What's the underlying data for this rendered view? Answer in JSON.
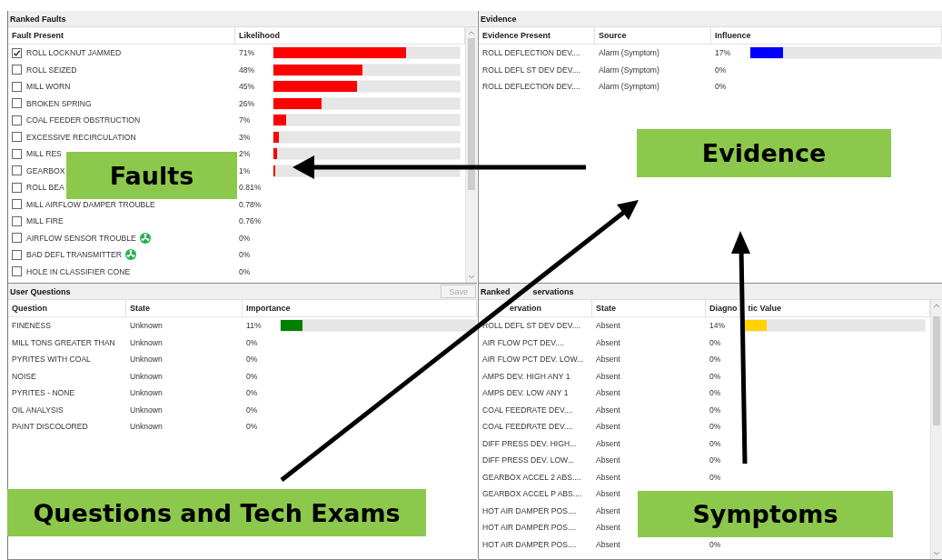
{
  "faults": {
    "title": "Ranked Faults",
    "columns": [
      "Fault Present",
      "Likelihood"
    ],
    "rows": [
      {
        "name": "ROLL LOCKNUT JAMMED",
        "checked": true,
        "icon": false,
        "value": "71%",
        "level": 0.71
      },
      {
        "name": "ROLL SEIZED",
        "checked": false,
        "icon": false,
        "value": "48%",
        "level": 0.48
      },
      {
        "name": "MILL WORN",
        "checked": false,
        "icon": false,
        "value": "45%",
        "level": 0.45
      },
      {
        "name": "BROKEN SPRING",
        "checked": false,
        "icon": false,
        "value": "26%",
        "level": 0.26
      },
      {
        "name": "COAL FEEDER OBSTRUCTION",
        "checked": false,
        "icon": false,
        "value": "7%",
        "level": 0.07
      },
      {
        "name": "EXCESSIVE RECIRCULATION",
        "checked": false,
        "icon": false,
        "value": "3%",
        "level": 0.03
      },
      {
        "name": "MILL RES",
        "checked": false,
        "icon": false,
        "value": "2%",
        "level": 0.02
      },
      {
        "name": "GEARBOX",
        "checked": false,
        "icon": false,
        "value": "1%",
        "level": 0.01
      },
      {
        "name": "ROLL BEA",
        "checked": false,
        "icon": false,
        "value": "0.81%"
      },
      {
        "name": "MILL AIRFLOW DAMPER TROUBLE",
        "checked": false,
        "icon": false,
        "value": "0.78%"
      },
      {
        "name": "MILL FIRE",
        "checked": false,
        "icon": false,
        "value": "0.76%"
      },
      {
        "name": "AIRFLOW SENSOR TROUBLE",
        "checked": false,
        "icon": true,
        "value": "0%"
      },
      {
        "name": "BAD DEFL TRANSMITTER",
        "checked": false,
        "icon": true,
        "value": "0%"
      },
      {
        "name": "HOLE IN CLASSIFIER CONE",
        "checked": false,
        "icon": false,
        "value": "0%"
      }
    ]
  },
  "evidence": {
    "title": "Evidence",
    "columns": [
      "Evidence Present",
      "Source",
      "Influence"
    ],
    "rows": [
      {
        "name": "ROLL DEFLECTION DEV....",
        "source": "Alarm (Symptom)",
        "value": "17%",
        "level": 0.17
      },
      {
        "name": "ROLL DEFL ST DEV DEV....",
        "source": "Alarm (Symptom)",
        "value": "0%"
      },
      {
        "name": "ROLL DEFLECTION DEV....",
        "source": "Alarm (Symptom)",
        "value": "0%"
      }
    ]
  },
  "questions": {
    "title": "User Questions",
    "save_button": {
      "label": "Save",
      "disabled": true
    },
    "columns": [
      "Question",
      "State",
      "Importance"
    ],
    "rows": [
      {
        "name": "FINENESS",
        "state": "Unknown",
        "value": "11%",
        "level": 0.11
      },
      {
        "name": "MILL TONS GREATER THAN",
        "state": "Unknown",
        "value": "0%"
      },
      {
        "name": "PYRITES WITH COAL",
        "state": "Unknown",
        "value": "0%"
      },
      {
        "name": "NOISE",
        "state": "Unknown",
        "value": "0%"
      },
      {
        "name": "PYRITES - NONE",
        "state": "Unknown",
        "value": "0%"
      },
      {
        "name": "OIL ANALYSIS",
        "state": "Unknown",
        "value": "0%"
      },
      {
        "name": "PAINT DISCOLORED",
        "state": "Unknown",
        "value": "0%"
      }
    ]
  },
  "observations": {
    "title": [
      "Ranked",
      "servations"
    ],
    "columns": [
      [
        "ervation"
      ],
      "State",
      [
        "Diagno",
        "tic Value"
      ]
    ],
    "rows": [
      {
        "name": "ROLL DEFL ST DEV DEV....",
        "state": "Absent",
        "value": "14%",
        "level": 0.14
      },
      {
        "name": "AIR FLOW PCT DEV....",
        "state": "Absent",
        "value": "0%"
      },
      {
        "name": "AIR FLOW PCT DEV. LOW...",
        "state": "Absent",
        "value": "0%"
      },
      {
        "name": "AMPS DEV. HIGH ANY 1",
        "state": "Absent",
        "value": "0%"
      },
      {
        "name": "AMPS DEV. LOW ANY 1",
        "state": "Absent",
        "value": "0%"
      },
      {
        "name": "COAL FEEDRATE DEV....",
        "state": "Absent",
        "value": "0%"
      },
      {
        "name": "COAL FEEDRATE DEV....",
        "state": "Absent",
        "value": "0%"
      },
      {
        "name": "DIFF PRESS DEV. HIGH...",
        "state": "Absent",
        "value": "0%"
      },
      {
        "name": "DIFF PRESS DEV. LOW...",
        "state": "Absent",
        "value": "0%"
      },
      {
        "name": "GEARBOX ACCEL 2 ABS....",
        "state": "Absent",
        "value": "0%"
      },
      {
        "name": "GEARBOX ACCEL P ABS....",
        "state": "Absent"
      },
      {
        "name": "HOT AIR DAMPER POS....",
        "state": "Absent"
      },
      {
        "name": "HOT AIR DAMPER POS....",
        "state": "Absent"
      },
      {
        "name": "HOT AIR DAMPER POS....",
        "state": "Absent",
        "value": "0%"
      }
    ]
  },
  "callouts": [
    {
      "label": "Faults"
    },
    {
      "label": "Evidence"
    },
    {
      "label": "Questions and Tech Exams"
    },
    {
      "label": "Symptoms"
    }
  ]
}
